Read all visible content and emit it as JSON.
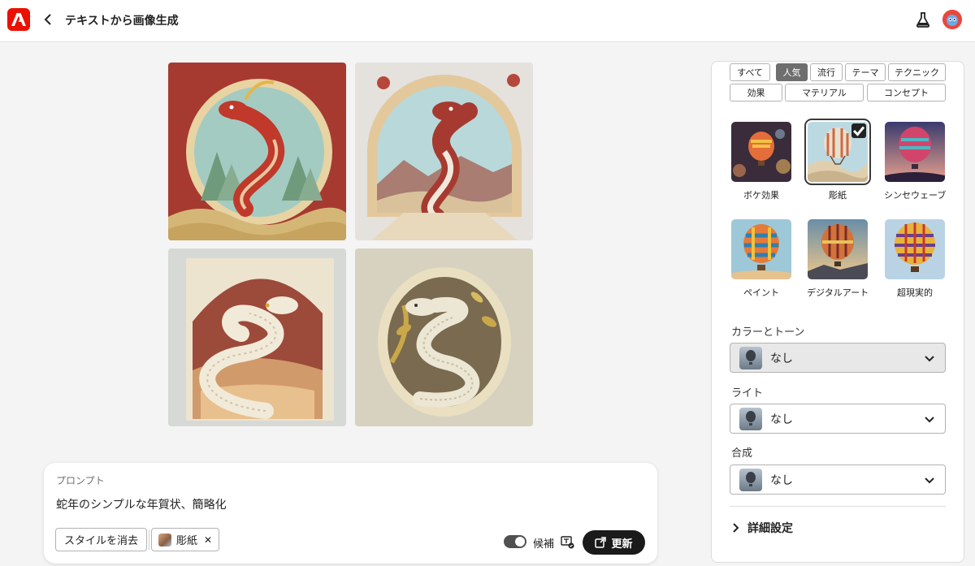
{
  "header": {
    "title": "テキストから画像生成",
    "icons": {
      "logo": "adobe-logo",
      "back": "chevron-left-icon",
      "labs": "flask-icon",
      "profile": "avatar"
    },
    "brand_color": "#eb1000"
  },
  "results": {
    "images": [
      {
        "name": "result-image-1",
        "theme": "red paper-cut snake with pine trees"
      },
      {
        "name": "result-image-2",
        "theme": "red and white snake in arch over hills"
      },
      {
        "name": "result-image-3",
        "theme": "white patterned snake on layered red paper"
      },
      {
        "name": "result-image-4",
        "theme": "cream snake with golden leaves in oval"
      }
    ]
  },
  "prompt": {
    "label": "プロンプト",
    "text": "蛇年のシンプルな年賀状、簡略化",
    "clear_style": "スタイルを消去",
    "style_chip": "彫紙",
    "candidates_label": "候補",
    "update_button": "更新"
  },
  "panel": {
    "filter_tabs": [
      {
        "label": "すべて",
        "active": false
      },
      {
        "label": "人気",
        "active": true
      },
      {
        "label": "流行",
        "active": false
      },
      {
        "label": "テーマ",
        "active": false
      },
      {
        "label": "テクニック",
        "active": false
      },
      {
        "label": "効果",
        "active": false
      },
      {
        "label": "マテリアル",
        "active": false
      },
      {
        "label": "コンセプト",
        "active": false
      }
    ],
    "styles": [
      {
        "label": "ボケ効果",
        "selected": false
      },
      {
        "label": "彫紙",
        "selected": true
      },
      {
        "label": "シンセウェーブ",
        "selected": false
      },
      {
        "label": "ペイント",
        "selected": false
      },
      {
        "label": "デジタルアート",
        "selected": false
      },
      {
        "label": "超現実的",
        "selected": false
      }
    ],
    "color_tone": {
      "label": "カラーとトーン",
      "value": "なし"
    },
    "light": {
      "label": "ライト",
      "value": "なし"
    },
    "composition": {
      "label": "合成",
      "value": "なし"
    },
    "advanced": "詳細設定"
  }
}
